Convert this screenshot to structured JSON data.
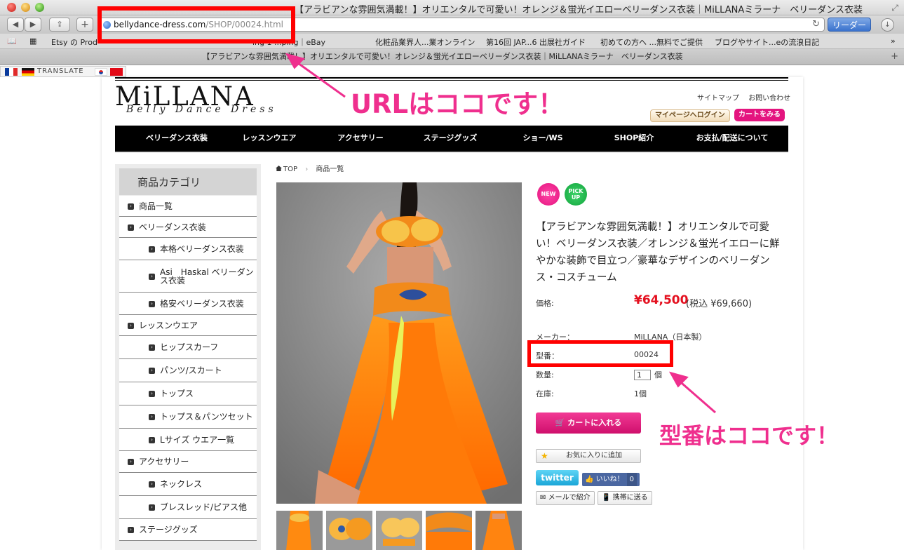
{
  "browser": {
    "window_title": "【アラビアンな雰囲気満載！】オリエンタルで可愛い！オレンジ＆蛍光イエローベリーダンス衣装｜MiLLANAミラーナ　ベリーダンス衣装",
    "url_host": "bellydance-dress.com",
    "url_path": "/SHOP/00024.html",
    "reader_label": "リーダー",
    "bookmarks": [
      "Etsy の Prod",
      "ing 1 ...ping｜eBay",
      "化粧品業界人...業オンライン",
      "第16回 JAP...6 出展社ガイド",
      "初めての方へ ...無料でご提供",
      "ブログやサイト...eの流浪日記"
    ],
    "tab_title": "【アラビアンな雰囲気満載！】オリエンタルで可愛い！オレンジ＆蛍光イエローベリーダンス衣装｜MiLLANAミラーナ　ベリーダンス衣装",
    "translate_label": "TRANSLATE"
  },
  "site": {
    "logo": "MiLLANA",
    "logo_sub": "Belly Dance Dress",
    "header_links": [
      "サイトマップ",
      "お問い合わせ"
    ],
    "mypage_label": "マイページへログイン",
    "cart_view_label": "カートをみる",
    "nav": [
      "ベリーダンス衣装",
      "レッスンウエア",
      "アクセサリー",
      "ステージグッズ",
      "ショー/WS",
      "SHOP紹介",
      "お支払/配送について"
    ]
  },
  "sidebar": {
    "heading": "商品カテゴリ",
    "items": [
      {
        "label": "商品一覧"
      },
      {
        "label": "ベリーダンス衣装"
      },
      {
        "label": "本格ベリーダンス衣装"
      },
      {
        "label": "Asi　Haskal ベリーダンス衣装"
      },
      {
        "label": "格安ベリーダンス衣装"
      },
      {
        "label": "レッスンウエア"
      },
      {
        "label": "ヒップスカーフ"
      },
      {
        "label": "パンツ/スカート"
      },
      {
        "label": "トップス"
      },
      {
        "label": "トップス＆パンツセット"
      },
      {
        "label": "Lサイズ ウエア一覧"
      },
      {
        "label": "アクセサリー"
      },
      {
        "label": "ネックレス"
      },
      {
        "label": "ブレスレッド/ピアス他"
      },
      {
        "label": "ステージグッズ"
      }
    ]
  },
  "breadcrumb": {
    "home": "TOP",
    "current": "商品一覧"
  },
  "product": {
    "badge_new": "NEW",
    "badge_pickup_1": "PICK",
    "badge_pickup_2": "UP",
    "title": "【アラビアンな雰囲気満載！】オリエンタルで可愛い！ベリーダンス衣装／オレンジ＆蛍光イエローに鮮やかな装飾で目立つ／豪華なデザインのベリーダンス・コスチューム",
    "price_label": "価格:",
    "price": "¥64,500",
    "price_tax": "(税込 ¥69,660)",
    "maker_label": "メーカー：",
    "maker": "MiLLANA（日本製）",
    "model_label": "型番：",
    "model": "00024",
    "qty_label": "数量:",
    "qty_value": "1",
    "qty_unit": "個",
    "stock_label": "在庫:",
    "stock": "1個",
    "add_to_cart": "カートに入れる",
    "favorite": "お気に入りに追加",
    "twitter": "twitter",
    "like": "いいね！",
    "like_count": "0",
    "mail": "メールで紹介",
    "mobile": "携帯に送る"
  },
  "annotations": {
    "url_note": "URLはココです！",
    "model_note": "型番はココです！",
    "color": "#ef2f8e",
    "box_color": "#ff0000"
  }
}
